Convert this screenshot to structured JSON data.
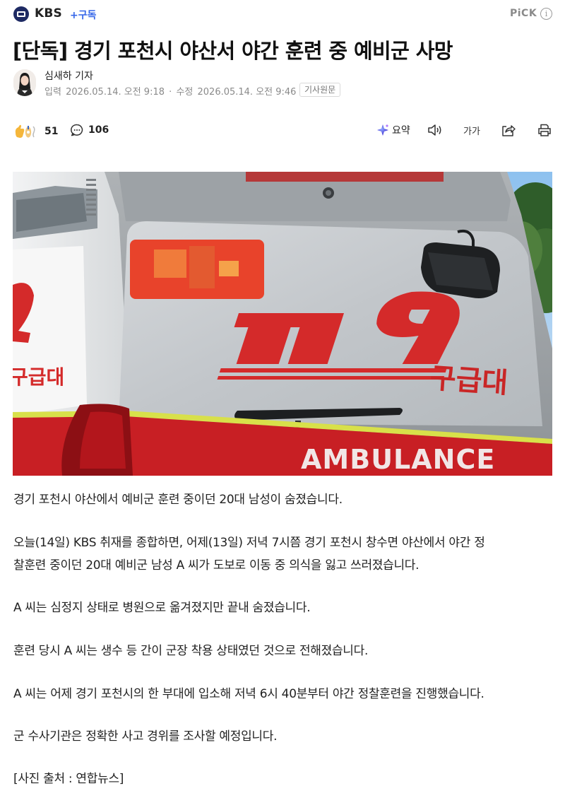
{
  "header": {
    "press_name": "KBS",
    "subscribe_label": "+구독",
    "pick_label": "PiCK",
    "info_icon_glyph": "i",
    "logo_icon": "kbs-logo-icon"
  },
  "article": {
    "headline": "[단독] 경기 포천시 야산서 야간 훈련 중 예비군 사망",
    "reporter": "심새하 기자",
    "input_label": "입력",
    "input_time": "2026.05.14. 오전 9:18",
    "separator": "·",
    "edit_label": "수정",
    "edit_time": "2026.05.14. 오전 9:46",
    "original_button": "기사원문"
  },
  "actions": {
    "reaction_count": "51",
    "comment_count": "106",
    "summary_label": "요약",
    "font_size_label": "가가",
    "icons": [
      "reaction-icon",
      "comment-icon",
      "summary-icon",
      "speaker-icon",
      "font-size-icon",
      "share-icon",
      "print-icon"
    ]
  },
  "photo": {
    "vehicle_number": "119",
    "side_text": "구급대",
    "rear_text": "구급대",
    "bumper_text": "AMBULANCE"
  },
  "paragraphs": [
    "경기 포천시 야산에서 예비군 훈련 중이던 20대 남성이 숨졌습니다.",
    "오늘(14일) KBS 취재를 종합하면, 어제(13일) 저녁 7시쯤 경기 포천시 창수면 야산에서 야간 정",
    "찰훈련 중이던 20대 예비군 남성 A 씨가 도보로 이동 중 의식을 잃고 쓰러졌습니다.",
    "A 씨는 심정지 상태로 병원으로 옮겨졌지만 끝내 숨졌습니다.",
    "훈련 당시 A 씨는 생수 등 간이 군장 착용 상태였던 것으로 전해졌습니다.",
    "A 씨는 어제 경기 포천시의 한 부대에 입소해 저녁 6시 40분부터 야간 정찰훈련을 진행했습니다.",
    "군 수사기관은 정확한 사고 경위를 조사할 예정입니다.",
    "[사진 출처 : 연합뉴스]"
  ],
  "colors": {
    "accent": "#3566e8",
    "logo_bg": "#1e2a63",
    "ambulance_red": "#d42a2a"
  }
}
